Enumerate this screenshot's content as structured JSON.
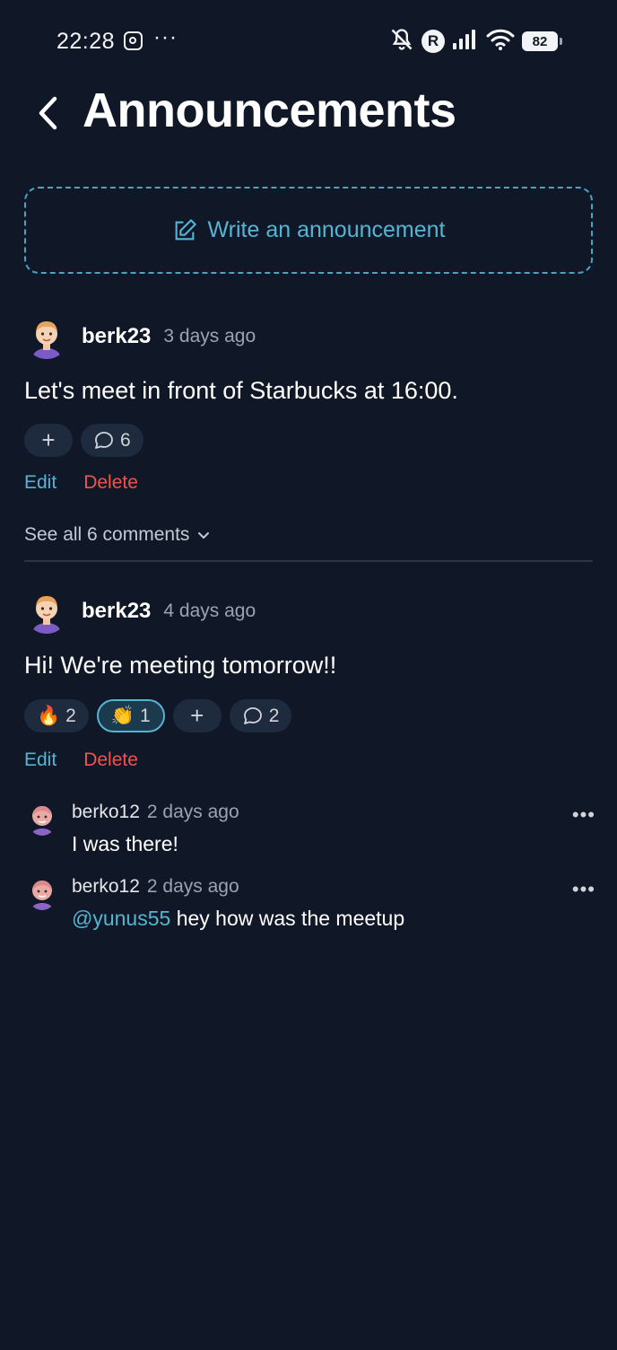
{
  "status_bar": {
    "time": "22:28",
    "dots": "···",
    "roaming_label": "R",
    "battery": "82"
  },
  "header": {
    "title": "Announcements"
  },
  "write": {
    "label": "Write an announcement"
  },
  "posts": [
    {
      "author": "berk23",
      "time": "3 days ago",
      "text": "Let's meet in front of Starbucks at 16:00.",
      "plus_label": "+",
      "comment_count": "6",
      "edit_label": "Edit",
      "delete_label": "Delete",
      "see_all_label": "See all 6 comments"
    },
    {
      "author": "berk23",
      "time": "4 days ago",
      "text": "Hi! We're meeting tomorrow!!",
      "reactions": [
        {
          "emoji": "🔥",
          "count": "2"
        },
        {
          "emoji": "👏",
          "count": "1"
        }
      ],
      "plus_label": "+",
      "comment_count": "2",
      "edit_label": "Edit",
      "delete_label": "Delete"
    }
  ],
  "comments": [
    {
      "author": "berko12",
      "time": "2 days ago",
      "text": "I was there!",
      "menu": "•••"
    },
    {
      "author": "berko12",
      "time": "2 days ago",
      "mention": "@yunus55",
      "text": " hey how was the meetup",
      "menu": "•••"
    }
  ],
  "colors": {
    "background": "#101827",
    "accent": "#56b4d3",
    "danger": "#ef5350",
    "pill": "#1e2a3d"
  },
  "icons": [
    "back-chevron-icon",
    "edit-note-icon",
    "comment-bubble-icon",
    "chevron-down-icon",
    "more-dots-icon",
    "muted-bell-icon",
    "signal-icon",
    "wifi-icon",
    "instagram-icon"
  ]
}
